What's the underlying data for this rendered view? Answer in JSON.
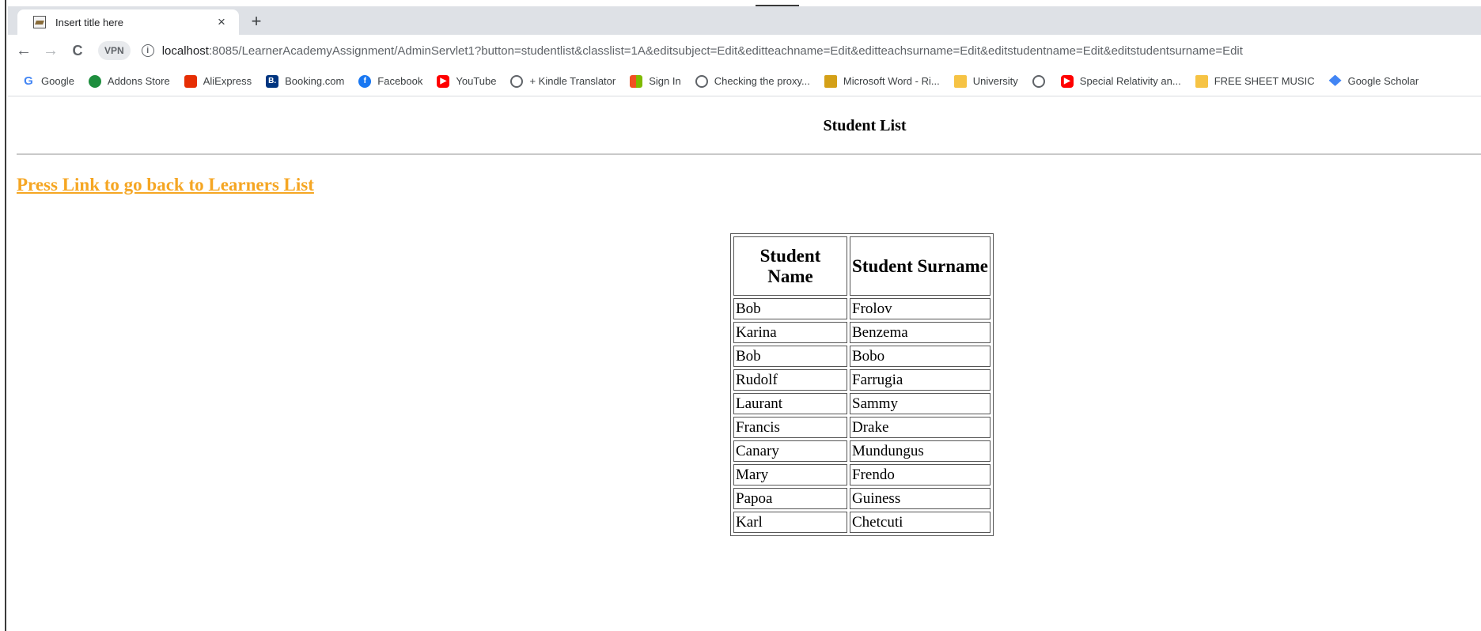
{
  "browser": {
    "tab_title": "Insert title here",
    "tab_close": "×",
    "new_tab": "+",
    "back": "←",
    "forward": "→",
    "reload": "C",
    "vpn": "VPN",
    "info": "i",
    "url_host": "localhost",
    "url_path": ":8085/LearnerAcademyAssignment/AdminServlet1?button=studentlist&classlist=1A&editsubject=Edit&editteachname=Edit&editteachsurname=Edit&editstudentname=Edit&editstudentsurname=Edit"
  },
  "bookmarks": [
    {
      "label": "Google",
      "icon": "google-icon",
      "glyph": "G"
    },
    {
      "label": "Addons Store",
      "icon": "addons-store-icon",
      "glyph": ""
    },
    {
      "label": "AliExpress",
      "icon": "aliexpress-icon",
      "glyph": ""
    },
    {
      "label": "Booking.com",
      "icon": "booking-icon",
      "glyph": "B."
    },
    {
      "label": "Facebook",
      "icon": "facebook-icon",
      "glyph": "f"
    },
    {
      "label": "YouTube",
      "icon": "youtube-icon",
      "glyph": "▶"
    },
    {
      "label": "+ Kindle Translator",
      "icon": "globe-icon",
      "glyph": ""
    },
    {
      "label": "Sign In",
      "icon": "microsoft-icon",
      "glyph": ""
    },
    {
      "label": "Checking the proxy...",
      "icon": "globe-icon",
      "glyph": ""
    },
    {
      "label": "Microsoft Word - Ri...",
      "icon": "word-doc-icon",
      "glyph": ""
    },
    {
      "label": "University",
      "icon": "folder-icon",
      "glyph": ""
    },
    {
      "label": "",
      "icon": "globe-icon",
      "glyph": ""
    },
    {
      "label": "Special Relativity an...",
      "icon": "youtube-icon",
      "glyph": "▶"
    },
    {
      "label": "FREE SHEET MUSIC",
      "icon": "folder-icon",
      "glyph": ""
    },
    {
      "label": "Google Scholar",
      "icon": "google-scholar-icon",
      "glyph": ""
    }
  ],
  "page": {
    "title": "Student List",
    "back_link": "Press Link to go back to Learners List",
    "table": {
      "headers": [
        "Student Name",
        "Student Surname"
      ],
      "rows": [
        [
          "Bob",
          "Frolov"
        ],
        [
          "Karina",
          "Benzema"
        ],
        [
          "Bob",
          "Bobo"
        ],
        [
          "Rudolf",
          "Farrugia"
        ],
        [
          "Laurant",
          "Sammy"
        ],
        [
          "Francis",
          "Drake"
        ],
        [
          "Canary",
          "Mundungus"
        ],
        [
          "Mary",
          "Frendo"
        ],
        [
          "Papoa",
          "Guiness"
        ],
        [
          "Karl",
          "Chetcuti"
        ]
      ]
    }
  },
  "colors": {
    "link": "#f5a623",
    "tabstrip": "#dee1e6"
  }
}
